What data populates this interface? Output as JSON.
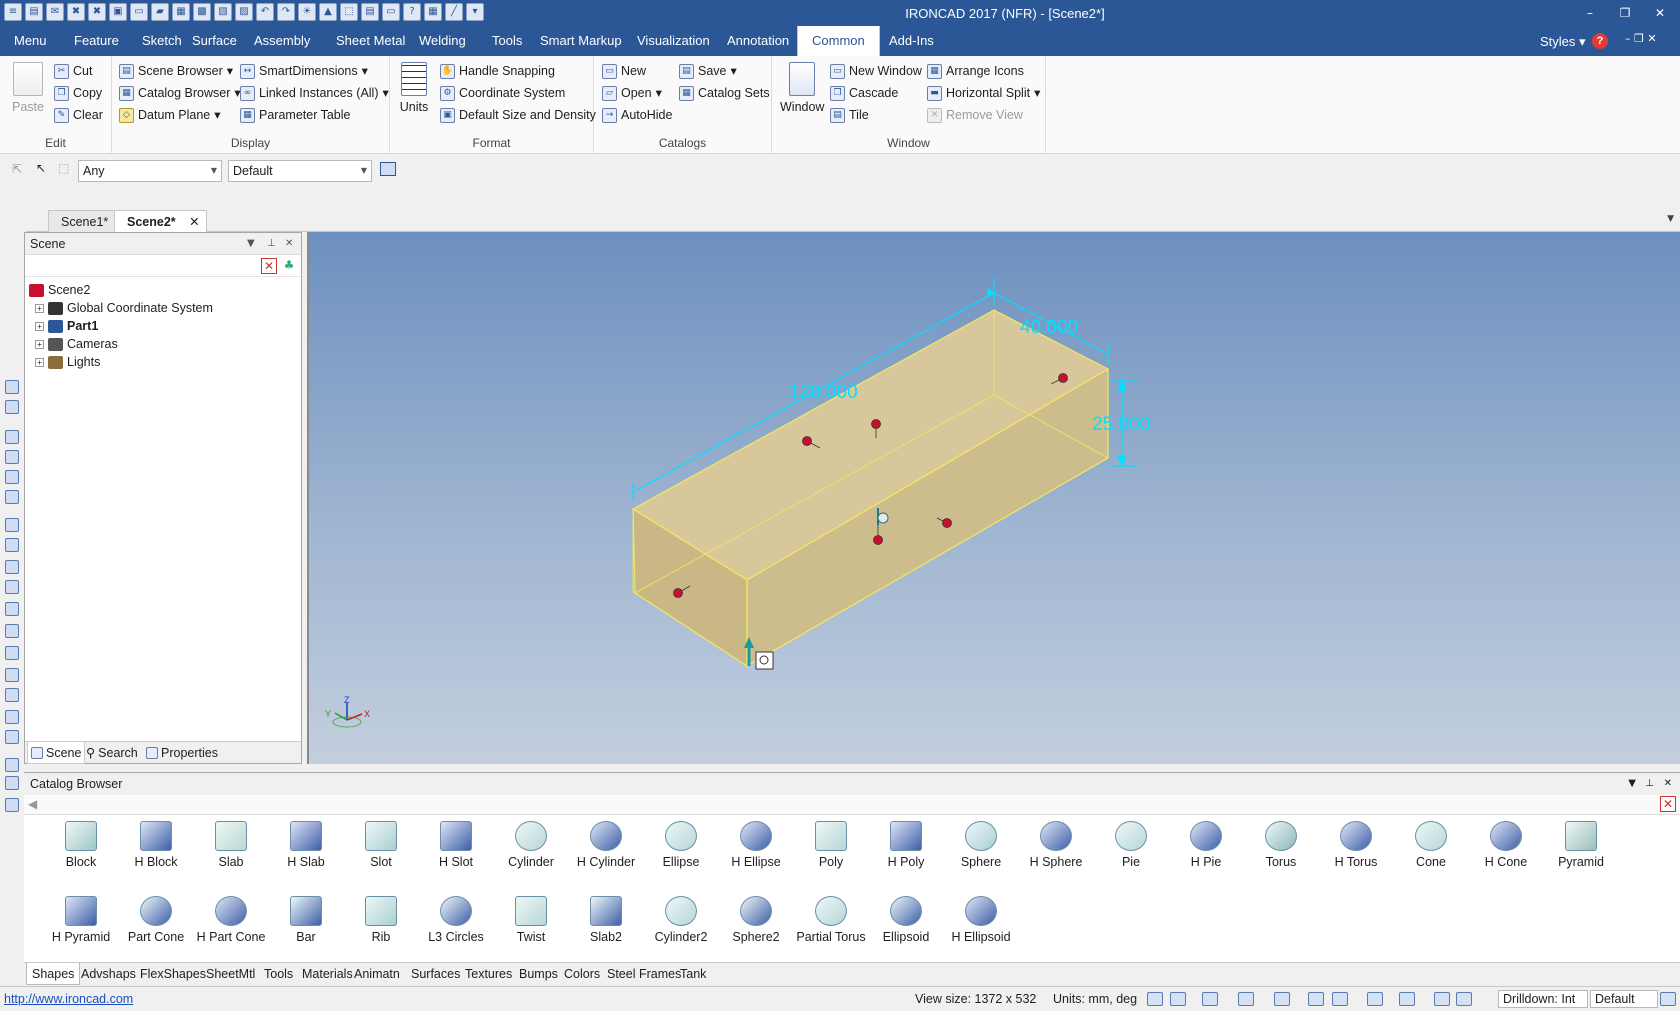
{
  "window": {
    "title": "IRONCAD 2017 (NFR) - [Scene2*]",
    "minimize": "–",
    "restore": "❐",
    "close": "✕"
  },
  "qat": [
    "≡",
    "▤",
    "✉",
    "✖",
    "✖",
    "▣",
    "▭",
    "▰",
    "▦",
    "▩",
    "▧",
    "▨",
    "↶",
    "↷",
    "☀",
    "▲",
    "⬚",
    "▤",
    "▭",
    "?",
    "▦",
    "╱",
    "▾"
  ],
  "menu": {
    "tabs": [
      "Menu",
      "Feature",
      "Sketch",
      "Surface",
      "Assembly",
      "Sheet Metal",
      "Welding",
      "Tools",
      "Smart Markup",
      "Visualization",
      "Annotation",
      "Common",
      "Add-Ins"
    ],
    "active": "Common",
    "styles_label": "Styles",
    "help_icon": "?"
  },
  "ribbon": {
    "edit": {
      "label": "Edit",
      "paste": "Paste",
      "cut": "Cut",
      "copy": "Copy",
      "clear": "Clear"
    },
    "display": {
      "label": "Display",
      "scene_browser": "Scene Browser",
      "catalog_browser": "Catalog Browser",
      "datum_plane": "Datum Plane",
      "smart_dimensions": "SmartDimensions",
      "linked_instances": "Linked Instances (All)",
      "parameter_table": "Parameter Table"
    },
    "format": {
      "label": "Format",
      "units": "Units",
      "handle_snapping": "Handle Snapping",
      "coordinate_system": "Coordinate System",
      "default_size": "Default Size and Density"
    },
    "catalogs": {
      "label": "Catalogs",
      "new": "New",
      "open": "Open",
      "autohide": "AutoHide",
      "save": "Save",
      "catalog_sets": "Catalog Sets"
    },
    "window": {
      "label": "Window",
      "window": "Window",
      "new_window": "New Window",
      "cascade": "Cascade",
      "tile": "Tile",
      "arrange_icons": "Arrange Icons",
      "horizontal_split": "Horizontal Split",
      "remove_view": "Remove View"
    }
  },
  "toolbar": {
    "filter_value": "Any",
    "style_value": "Default"
  },
  "doc_tabs": [
    "Scene1*",
    "Scene2*"
  ],
  "scene_panel": {
    "title": "Scene",
    "tree": [
      {
        "label": "Scene2",
        "bold": false,
        "expander": false
      },
      {
        "label": "Global Coordinate System",
        "bold": false,
        "expander": true
      },
      {
        "label": "Part1",
        "bold": true,
        "expander": true
      },
      {
        "label": "Cameras",
        "bold": false,
        "expander": true
      },
      {
        "label": "Lights",
        "bold": false,
        "expander": true
      }
    ],
    "footer_tabs": [
      "Scene",
      "Search",
      "Properties"
    ]
  },
  "viewport": {
    "dim_length": "120.000",
    "dim_width": "40.000",
    "dim_height": "25.000",
    "triad": {
      "x": "X",
      "y": "Y",
      "z": "Z"
    }
  },
  "catalog": {
    "title": "Catalog Browser",
    "items_row1": [
      "Block",
      "H Block",
      "Slab",
      "H Slab",
      "Slot",
      "H Slot",
      "Cylinder",
      "H Cylinder",
      "Ellipse",
      "H Ellipse",
      "Poly",
      "H Poly",
      "Sphere",
      "H Sphere",
      "Pie",
      "H Pie",
      "Torus",
      "H Torus",
      "Cone",
      "H Cone",
      "Pyramid"
    ],
    "items_row2": [
      "H Pyramid",
      "Part Cone",
      "H Part Cone",
      "Bar",
      "Rib",
      "L3 Circles",
      "Twist",
      "Slab2",
      "Cylinder2",
      "Sphere2",
      "Partial Torus",
      "Ellipsoid",
      "H Ellipsoid"
    ],
    "tabs": [
      "Shapes",
      "Advshaps",
      "FlexShapes",
      "SheetMtl",
      "Tools",
      "Materials",
      "Animatn",
      "Surfaces",
      "Textures",
      "Bumps",
      "Colors",
      "Steel Frames",
      "Tank"
    ],
    "active_tab": "Shapes"
  },
  "status": {
    "url": "http://www.ironcad.com",
    "view_size": "View size: 1372 x  532",
    "units": "Units: mm, deg",
    "drilldown": "Drilldown: Int",
    "style": "Default"
  },
  "colors": {
    "accent": "#2b5797",
    "dimension": "#00e0ff",
    "part_face": "#c9b886",
    "handle": "#c8102e"
  }
}
